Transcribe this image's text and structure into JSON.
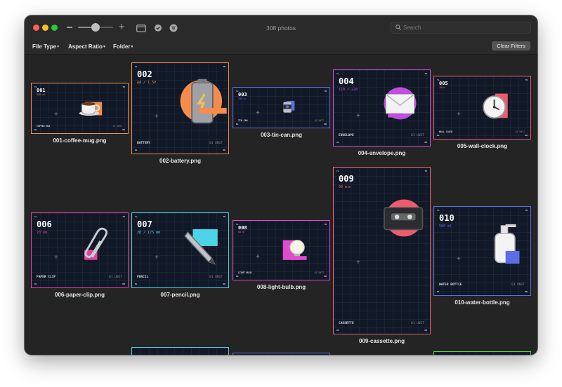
{
  "window": {
    "title": "308 photos",
    "search_placeholder": "Search"
  },
  "zoom": {
    "level": 0.5
  },
  "filters": [
    {
      "label": "File Type"
    },
    {
      "label": "Aspect Ratio"
    },
    {
      "label": "Folder"
    }
  ],
  "clear_filters_label": "Clear Filters",
  "photos": [
    {
      "id": "001",
      "filename": "001-coffee-mug.png",
      "spec": "350 ml",
      "label": "COFFEE MUG",
      "unit": "01 UNIT",
      "accent": "#f58c4c"
    },
    {
      "id": "002",
      "filename": "002-battery.png",
      "spec": "AA / 1.5V",
      "label": "BATTERY",
      "unit": "01 UNIT",
      "accent": "#f58c4c"
    },
    {
      "id": "003",
      "filename": "003-tin-can.png",
      "spec": "330 g",
      "label": "TIN CAN",
      "unit": "01 UNIT",
      "accent": "#5b6ee8"
    },
    {
      "id": "004",
      "filename": "004-envelope.png",
      "spec": "110 × 220",
      "label": "ENVELOPE",
      "unit": "01 UNIT",
      "accent": "#c04ee0"
    },
    {
      "id": "005",
      "filename": "005-wall-clock.png",
      "spec": "30cm",
      "label": "WALL CLOCK",
      "unit": "01 UNIT",
      "accent": "#ee5c6c"
    },
    {
      "id": "006",
      "filename": "006-paper-clip.png",
      "spec": "70 mm",
      "label": "PAPER CLIP",
      "unit": "01 UNIT",
      "accent": "#e0459e"
    },
    {
      "id": "007",
      "filename": "007-pencil.png",
      "spec": "2B / 175 mm",
      "label": "PENCIL",
      "unit": "01 UNIT",
      "accent": "#4ed4e8"
    },
    {
      "id": "008",
      "filename": "008-light-bulb.png",
      "spec": "60 W",
      "label": "LIGHT BULB",
      "unit": "01 UNIT",
      "accent": "#e04cd0"
    },
    {
      "id": "009",
      "filename": "009-cassette.png",
      "spec": "90 min",
      "label": "CASSETTE",
      "unit": "01 UNIT",
      "accent": "#ee5c6c"
    },
    {
      "id": "010",
      "filename": "010-water-bottle.png",
      "spec": "500 ml",
      "label": "WATER BOTTLE",
      "unit": "01 UNIT",
      "accent": "#5b6ee8"
    }
  ],
  "corners": {
    "tl": "TL",
    "tr": "TR",
    "bl": "BL",
    "br": "BR"
  },
  "partial_row_accents": [
    "#4ed4e8",
    "#5b6ee8",
    "#5ed44e"
  ]
}
